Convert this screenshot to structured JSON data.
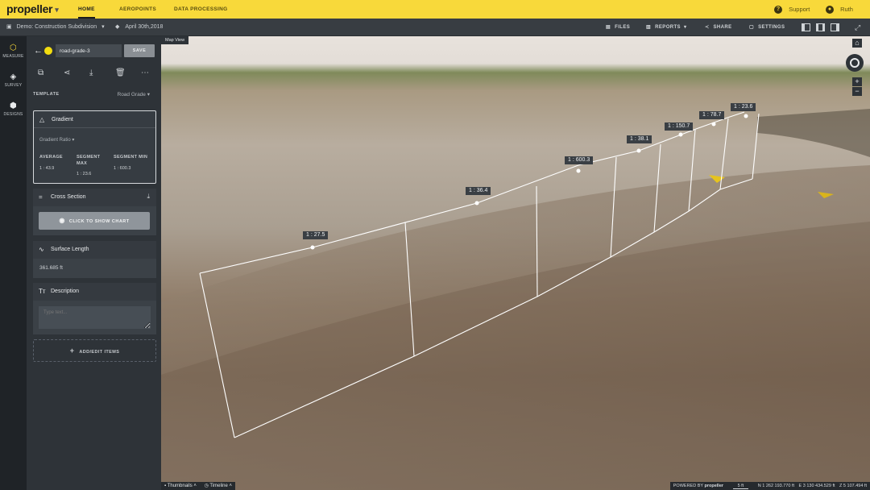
{
  "topbar": {
    "logo": "propeller",
    "nav": [
      "HOME",
      "AEROPOINTS",
      "DATA PROCESSING"
    ],
    "support": "Support",
    "user": "Ruth"
  },
  "subbar": {
    "project": "Demo: Construction Subdivision",
    "date": "April 30th,2018",
    "files": "FILES",
    "reports": "REPORTS",
    "share": "SHARE",
    "settings": "SETTINGS"
  },
  "rail": {
    "measure": "MEASURE",
    "survey": "SURVEY",
    "designs": "DESIGNS"
  },
  "panel": {
    "name_value": "road-grade-3",
    "save": "SAVE",
    "template_label": "TEMPLATE",
    "template_value": "Road Grade",
    "gradient": {
      "title": "Gradient",
      "ratio_select": "Gradient Ratio",
      "average_label": "AVERAGE",
      "average_value": "1 : 43.9",
      "segment_max_label": "SEGMENT MAX",
      "segment_max_value": "1 : 23.6",
      "segment_min_label": "SEGMENT MIN",
      "segment_min_value": "1 : 600.3"
    },
    "cross_section": {
      "title": "Cross Section",
      "button": "CLICK TO SHOW CHART"
    },
    "surface_length": {
      "title": "Surface Length",
      "value": "361.685 ft"
    },
    "description": {
      "title": "Description",
      "placeholder": "Type text..."
    },
    "add_items": "ADD/EDIT ITEMS"
  },
  "map": {
    "view_label": "Map View",
    "grade_labels": [
      "1 : 27.5",
      "1 : 36.4",
      "1 : 600.3",
      "1 : 38.1",
      "1 : 150.7",
      "1 : 78.7",
      "1 : 23.6"
    ],
    "thumbnails": "Thumbnails",
    "timeline": "Timeline",
    "powered_by": "POWERED BY",
    "powered_brand": "propeller",
    "scale": "5 ft",
    "coord_n": "N 1 262 193.770 ft",
    "coord_e": "E 3 130 434.529 ft",
    "coord_z": "Z 5 107.494 ft"
  },
  "colors": {
    "brand_yellow": "#f8d93a",
    "panel": "#2e3338",
    "rail": "#1f2327"
  }
}
